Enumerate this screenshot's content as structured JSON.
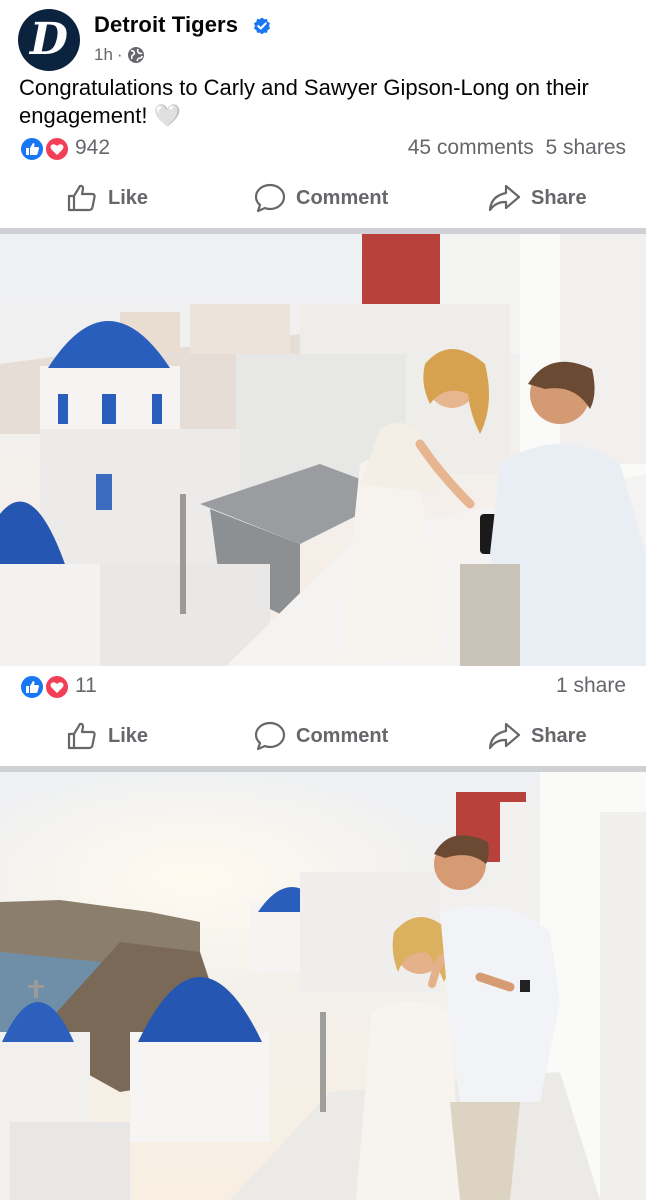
{
  "post": {
    "page_name": "Detroit Tigers",
    "avatar_letter": "D",
    "time": "1h",
    "separator": "·",
    "caption": "Congratulations to Carly and Sawyer Gipson-Long on their engagement! 🤍",
    "reaction_count": "942",
    "comments": "45 comments",
    "shares": "5 shares"
  },
  "photo1": {
    "reaction_count": "11",
    "shares": "1 share"
  },
  "actions": {
    "like": "Like",
    "comment": "Comment",
    "share": "Share"
  },
  "colors": {
    "like_blue": "#1877f2",
    "love_red": "#f33e58",
    "tigers_navy": "#0c2340",
    "dome_blue": "#2a5ebd"
  }
}
